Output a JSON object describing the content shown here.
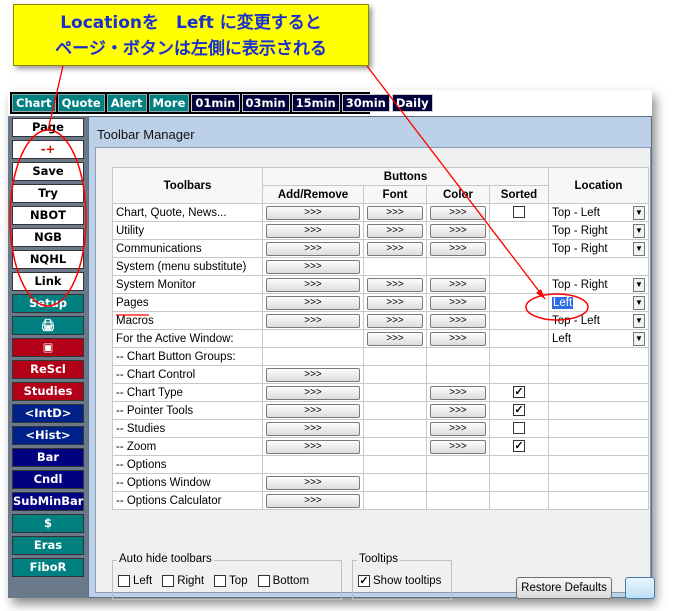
{
  "callout": {
    "line1": "Locationを　Left に変更すると",
    "line2": "ページ・ボタンは左側に表示される"
  },
  "topbar": {
    "buttons": [
      "Chart",
      "Quote",
      "Alert",
      "More",
      "01min",
      "03min",
      "15min",
      "30min",
      "Daily"
    ]
  },
  "leftcol": {
    "buttons": [
      "Page",
      "-+",
      "Save",
      "Try",
      "NBOT",
      "NGB",
      "NQHL",
      "Link",
      "Setup",
      "print-icon",
      "exit-icon",
      "ReScl",
      "Studies",
      "<IntD>",
      "<Hist>",
      "Bar",
      "Cndl",
      "SubMinBar",
      "$",
      "Eras",
      "FiboR"
    ]
  },
  "dialog": {
    "title": "Toolbar Manager",
    "headers": {
      "toolbars": "Toolbars",
      "buttons": "Buttons",
      "add_remove": "Add/Remove",
      "font": "Font",
      "color": "Color",
      "sorted": "Sorted",
      "location": "Location"
    },
    "btn_text": ">>>",
    "rows": [
      {
        "name": "Chart, Quote, News...",
        "add": true,
        "font": true,
        "color": true,
        "sorted": "off",
        "location": "Top - Left"
      },
      {
        "name": "Utility",
        "add": true,
        "font": true,
        "color": true,
        "sorted": "",
        "location": "Top - Right"
      },
      {
        "name": "Communications",
        "add": true,
        "font": true,
        "color": true,
        "sorted": "",
        "location": "Top - Right"
      },
      {
        "name": "System (menu substitute)",
        "add": true,
        "font": false,
        "color": false,
        "sorted": "",
        "location": ""
      },
      {
        "name": "System Monitor",
        "add": true,
        "font": true,
        "color": true,
        "sorted": "",
        "location": "Top - Right"
      },
      {
        "name": "Pages",
        "add": true,
        "font": true,
        "color": true,
        "sorted": "",
        "location": "Left"
      },
      {
        "name": "Macros",
        "add": true,
        "font": true,
        "color": true,
        "sorted": "",
        "location": "Top - Left"
      },
      {
        "name": "For the Active Window:",
        "add": false,
        "font": true,
        "color": true,
        "sorted": "",
        "location": "Left"
      },
      {
        "name": "-- Chart Button Groups:",
        "add": false,
        "font": false,
        "color": false,
        "sorted": "",
        "location": ""
      },
      {
        "name": "-- Chart Control",
        "add": true,
        "font": false,
        "color": false,
        "sorted": "",
        "location": ""
      },
      {
        "name": "-- Chart Type",
        "add": true,
        "font": false,
        "color": true,
        "sorted": "on",
        "location": ""
      },
      {
        "name": "-- Pointer Tools",
        "add": true,
        "font": false,
        "color": true,
        "sorted": "on",
        "location": ""
      },
      {
        "name": "-- Studies",
        "add": true,
        "font": false,
        "color": true,
        "sorted": "off",
        "location": ""
      },
      {
        "name": "-- Zoom",
        "add": true,
        "font": false,
        "color": true,
        "sorted": "on",
        "location": ""
      },
      {
        "name": "-- Options",
        "add": false,
        "font": false,
        "color": false,
        "sorted": "",
        "location": ""
      },
      {
        "name": "-- Options Window",
        "add": true,
        "font": false,
        "color": false,
        "sorted": "",
        "location": ""
      },
      {
        "name": "-- Options Calculator",
        "add": true,
        "font": false,
        "color": false,
        "sorted": "",
        "location": ""
      }
    ],
    "autohide": {
      "title": "Auto hide toolbars",
      "options": [
        "Left",
        "Right",
        "Top",
        "Bottom"
      ]
    },
    "tooltips": {
      "title": "Tooltips",
      "option": "Show tooltips",
      "checked": true
    },
    "restore_label": "Restore Defaults"
  },
  "colors": {
    "callout_bg": "#ffff00",
    "callout_text": "#1a2fd0",
    "annotation_red": "#ff0000",
    "selection_blue": "#2e6be6"
  }
}
